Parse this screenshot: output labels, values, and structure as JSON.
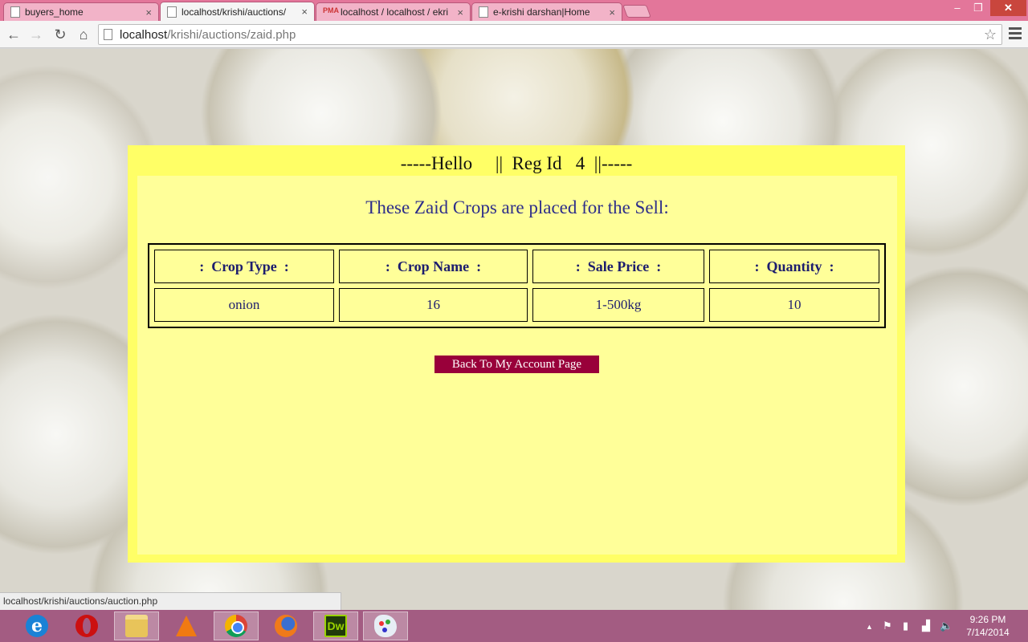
{
  "browser": {
    "tabs": [
      {
        "label": "buyers_home",
        "close": "×"
      },
      {
        "label": "localhost/krishi/auctions/",
        "close": "×"
      },
      {
        "label": "localhost / localhost / ekri",
        "close": "×"
      },
      {
        "label": "e-krishi darshan|Home",
        "close": "×"
      }
    ],
    "pma_icon_text": "PMA",
    "window_controls": {
      "minimize": "‒",
      "maximize": "❐",
      "close": "✕"
    },
    "nav": {
      "back": "←",
      "forward": "→",
      "reload": "↻",
      "home": "⌂"
    },
    "address": {
      "host": "localhost",
      "path": "/krishi/auctions/zaid.php"
    },
    "star": "☆",
    "status_url": "localhost/krishi/auctions/auction.php"
  },
  "page": {
    "greeting": "-----Hello     ||  Reg Id   4  ||-----",
    "subtitle": "These Zaid Crops are placed for the Sell:",
    "table": {
      "headers": [
        ":  Crop Type  :",
        ":  Crop Name  :",
        ":  Sale Price  :",
        ":  Quantity  :"
      ],
      "rows": [
        [
          "onion",
          "16",
          "1-500kg",
          "10"
        ]
      ]
    },
    "back_button": "Back To My Account Page"
  },
  "taskbar": {
    "ie_glyph": "e",
    "dw_label": "Dw",
    "tray_arrow": "▲",
    "tray_flag": "⚑",
    "tray_power": "▮",
    "tray_network": "▟",
    "tray_volume": "🔈",
    "time": "9:26 PM",
    "date": "7/14/2014"
  }
}
